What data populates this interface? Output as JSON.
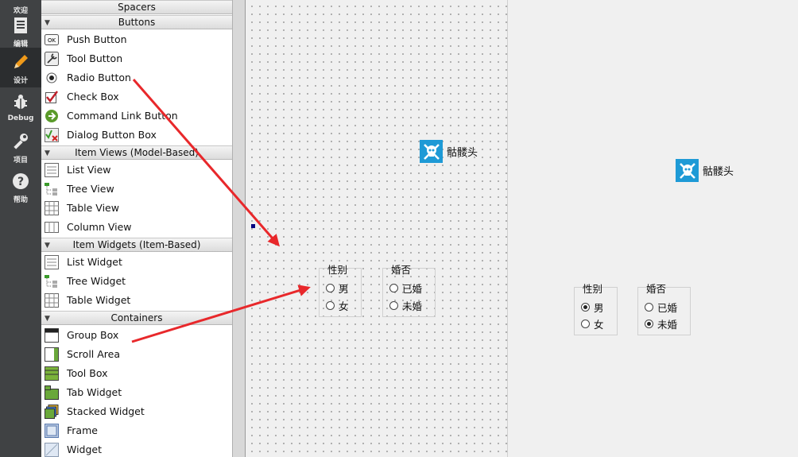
{
  "modebar": {
    "items": [
      {
        "label": "欢迎",
        "icon": "welcome-icon"
      },
      {
        "label": "编辑",
        "icon": "edit-document-icon"
      },
      {
        "label": "设计",
        "icon": "design-pencil-icon"
      },
      {
        "label": "Debug",
        "icon": "debug-bug-icon"
      },
      {
        "label": "项目",
        "icon": "project-wrench-icon"
      },
      {
        "label": "帮助",
        "icon": "help-icon"
      }
    ],
    "active": "设计"
  },
  "widget_box": {
    "categories": {
      "spacers": "Spacers",
      "buttons": "Buttons",
      "item_views": "Item Views (Model-Based)",
      "item_widgets": "Item Widgets (Item-Based)",
      "containers": "Containers"
    },
    "buttons": [
      "Push Button",
      "Tool Button",
      "Radio Button",
      "Check Box",
      "Command Link Button",
      "Dialog Button Box"
    ],
    "item_views": [
      "List View",
      "Tree View",
      "Table View",
      "Column View"
    ],
    "item_widgets": [
      "List Widget",
      "Tree Widget",
      "Table Widget"
    ],
    "containers": [
      "Group Box",
      "Scroll Area",
      "Tool Box",
      "Tab Widget",
      "Stacked Widget",
      "Frame",
      "Widget"
    ]
  },
  "form": {
    "logo_text": "骷髅头",
    "gender_group": {
      "title": "性别",
      "options": [
        "男",
        "女"
      ]
    },
    "marital_group": {
      "title": "婚否",
      "options": [
        "已婚",
        "未婚"
      ]
    }
  },
  "preview": {
    "logo_text": "骷髅头",
    "gender_group": {
      "title": "性别",
      "options": [
        "男",
        "女"
      ],
      "checked": "男"
    },
    "marital_group": {
      "title": "婚否",
      "options": [
        "已婚",
        "未婚"
      ],
      "checked": "未婚"
    }
  },
  "colors": {
    "arrow": "#e8282b",
    "logo_badge": "#1e9ad6",
    "modebar": "#404244"
  }
}
